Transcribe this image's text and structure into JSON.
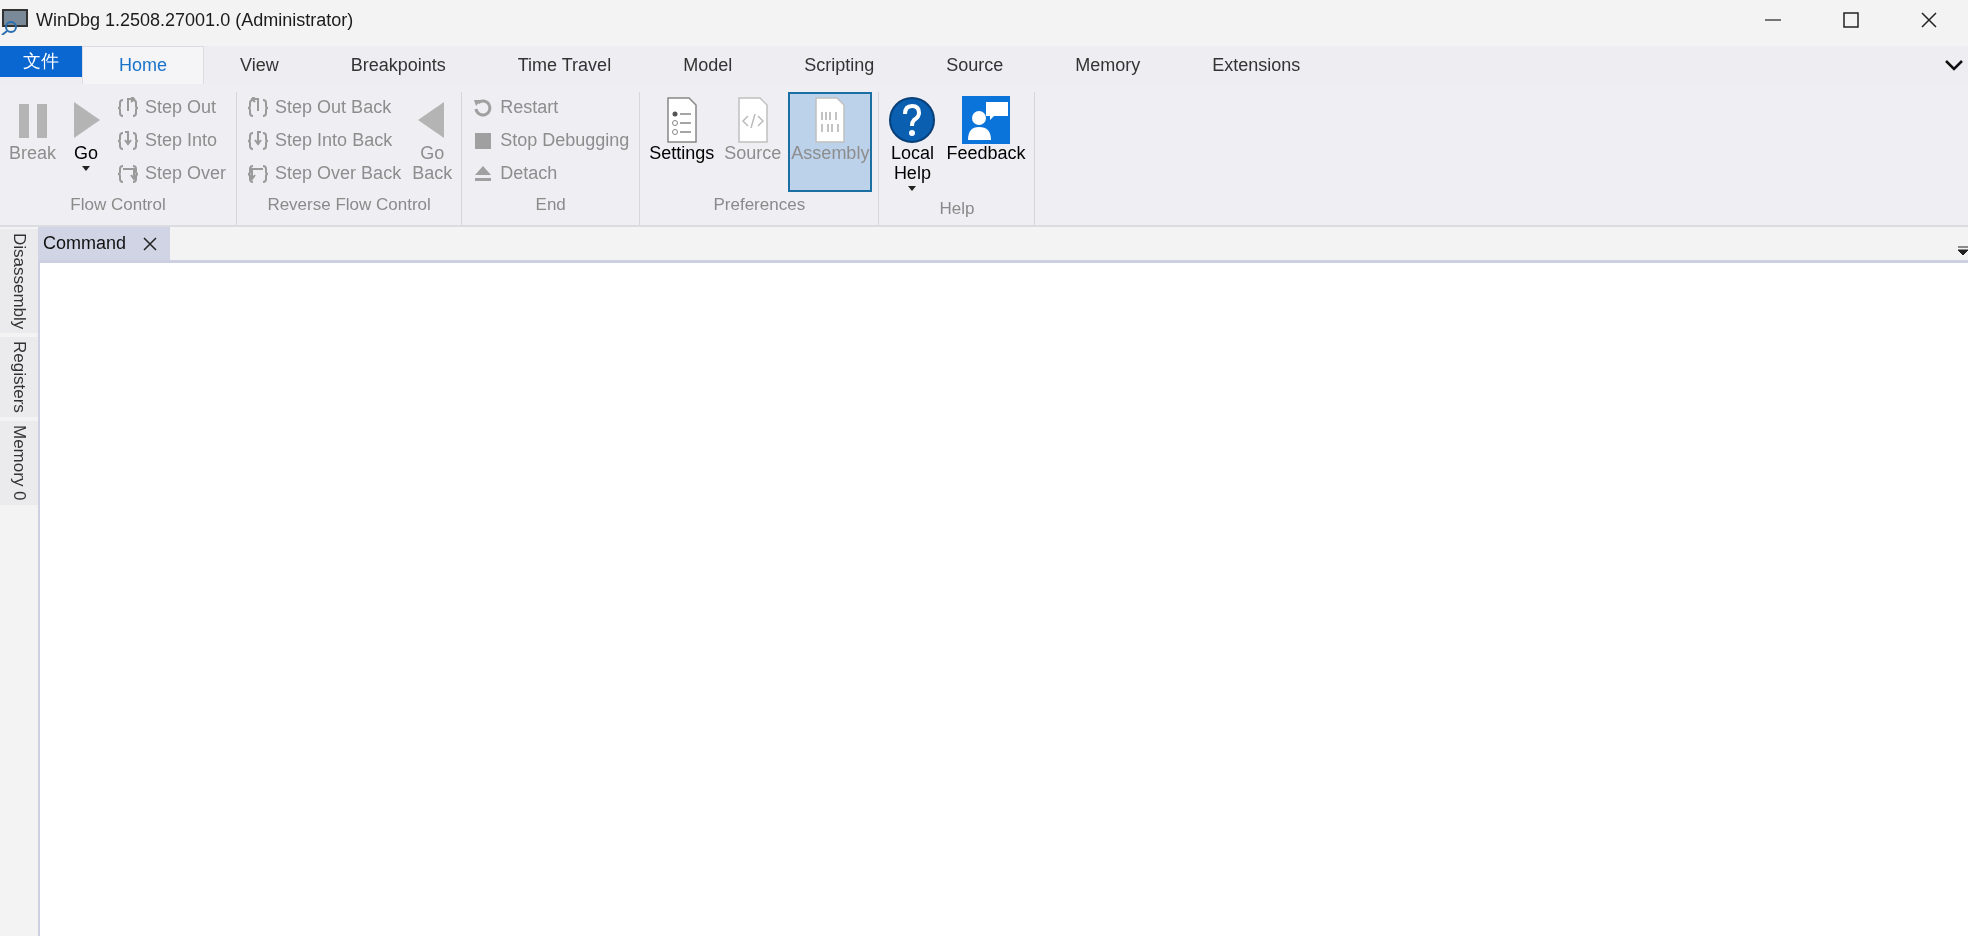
{
  "window": {
    "title": "WinDbg 1.2508.27001.0 (Administrator)"
  },
  "ribbon": {
    "file_tab": "文件",
    "tabs": [
      {
        "label": "Home",
        "selected": true
      },
      {
        "label": "View",
        "selected": false
      },
      {
        "label": "Breakpoints",
        "selected": false
      },
      {
        "label": "Time Travel",
        "selected": false
      },
      {
        "label": "Model",
        "selected": false
      },
      {
        "label": "Scripting",
        "selected": false
      },
      {
        "label": "Source",
        "selected": false
      },
      {
        "label": "Memory",
        "selected": false
      },
      {
        "label": "Extensions",
        "selected": false
      }
    ],
    "groups": [
      {
        "label": "Flow Control",
        "items": [
          {
            "kind": "large",
            "label": "Break",
            "disabled": true
          },
          {
            "kind": "large",
            "label": "Go",
            "disabled": false,
            "dropdown": true
          },
          {
            "kind": "stack",
            "items": [
              {
                "label": "Step Out",
                "disabled": true
              },
              {
                "label": "Step Into",
                "disabled": true
              },
              {
                "label": "Step Over",
                "disabled": true
              }
            ]
          }
        ]
      },
      {
        "label": "Reverse Flow Control",
        "items": [
          {
            "kind": "stack",
            "items": [
              {
                "label": "Step Out Back",
                "disabled": true
              },
              {
                "label": "Step Into Back",
                "disabled": true
              },
              {
                "label": "Step Over Back",
                "disabled": true
              }
            ]
          },
          {
            "kind": "large",
            "label": "Go Back",
            "disabled": true
          }
        ]
      },
      {
        "label": "End",
        "items": [
          {
            "kind": "stack",
            "items": [
              {
                "label": "Restart",
                "disabled": true
              },
              {
                "label": "Stop Debugging",
                "disabled": true
              },
              {
                "label": "Detach",
                "disabled": true
              }
            ]
          }
        ]
      },
      {
        "label": "Preferences",
        "items": [
          {
            "kind": "large",
            "label": "Settings",
            "disabled": false,
            "checked": false
          },
          {
            "kind": "large",
            "label": "Source",
            "disabled": true,
            "checked": false
          },
          {
            "kind": "large",
            "label": "Assembly",
            "disabled": true,
            "checked": true
          }
        ]
      },
      {
        "label": "Help",
        "items": [
          {
            "kind": "large",
            "label": "Local Help",
            "disabled": false,
            "dropdown": true
          },
          {
            "kind": "large",
            "label": "Feedback",
            "disabled": false
          }
        ]
      }
    ]
  },
  "side_tabs": [
    {
      "label": "Disassembly"
    },
    {
      "label": "Registers"
    },
    {
      "label": "Memory 0"
    }
  ],
  "documents": [
    {
      "label": "Command",
      "selected": true
    }
  ]
}
